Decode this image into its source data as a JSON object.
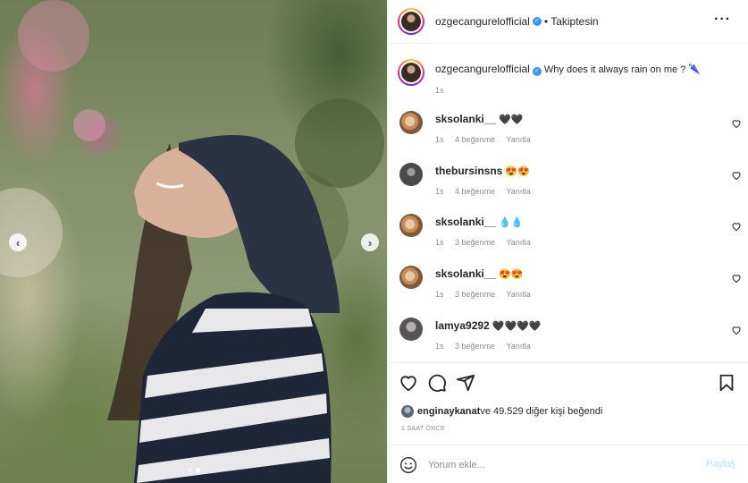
{
  "post": {
    "username": "ozgecangurelofficial",
    "follow_status": "Takiptesin",
    "more_icon": "more-horizontal-icon",
    "image": {
      "slide_count": 2,
      "active_slide": 2
    }
  },
  "caption": {
    "username": "ozgecangurelofficial",
    "text": "Why does it always rain on me ? 🌂",
    "time": "1s"
  },
  "comments": [
    {
      "username": "sksolanki__",
      "text": "🖤🖤",
      "time": "1s",
      "likes": "4 beğenme",
      "reply": "Yanıtla",
      "avatar_color": "#c98a5a"
    },
    {
      "username": "thebursinsns",
      "text": "😍😍",
      "time": "1s",
      "likes": "4 beğenme",
      "reply": "Yanıtla",
      "avatar_color": "#4a4a4a"
    },
    {
      "username": "sksolanki__",
      "text": "💧💧",
      "time": "1s",
      "likes": "3 beğenme",
      "reply": "Yanıtla",
      "avatar_color": "#c98a5a"
    },
    {
      "username": "sksolanki__",
      "text": "😍😍",
      "time": "1s",
      "likes": "3 beğenme",
      "reply": "Yanıtla",
      "avatar_color": "#c98a5a"
    },
    {
      "username": "lamya9292",
      "text": "🖤🖤🖤🖤",
      "time": "1s",
      "likes": "3 beğenme",
      "reply": "Yanıtla",
      "avatar_color": "#555555"
    }
  ],
  "likes": {
    "liker": "enginaykanat",
    "rest": " ve 49.529 diğer kişi beğendi"
  },
  "timeago": "1 SAAT ÖNCE",
  "composer": {
    "placeholder": "Yorum ekle...",
    "post_label": "Paylaş"
  },
  "colors": {
    "verified": "#3897f0",
    "secondary_text": "#8e8e8e",
    "post_disabled": "#b2dffc"
  }
}
